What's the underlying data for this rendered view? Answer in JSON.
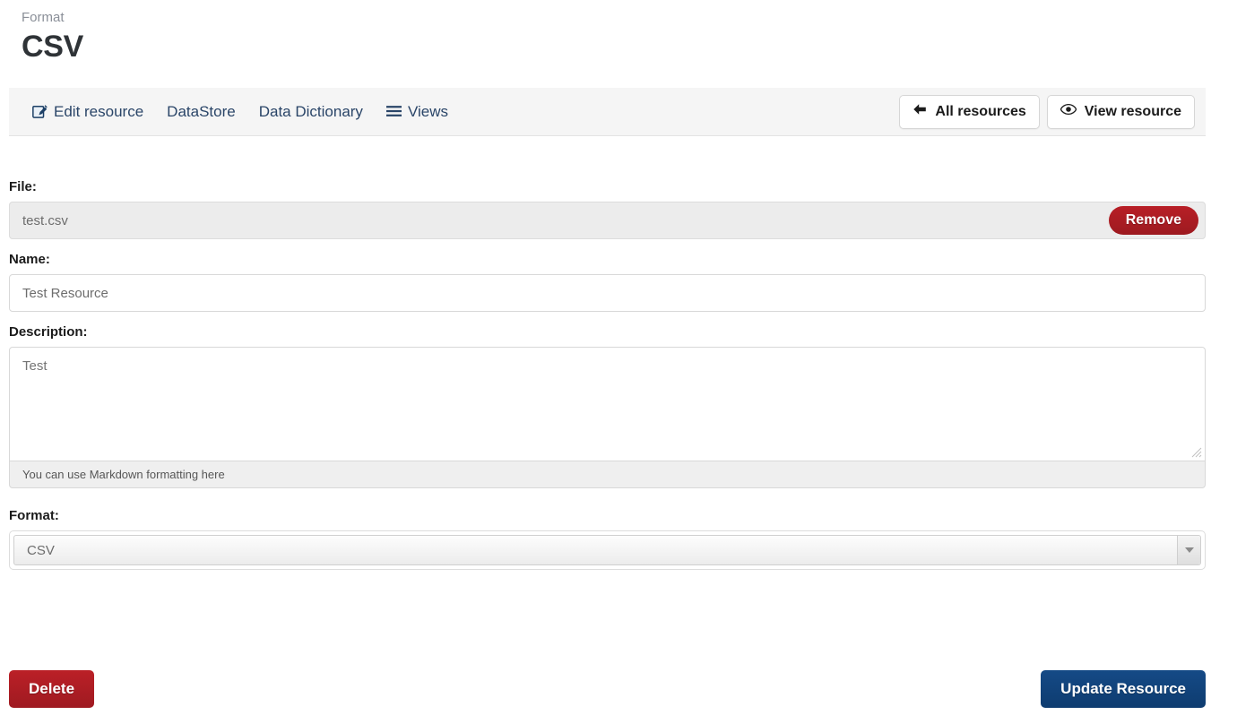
{
  "header": {
    "eyebrow": "Format",
    "title": "CSV"
  },
  "nav": {
    "tabs": [
      {
        "label": "Edit resource",
        "icon": "edit-square-icon",
        "active": true
      },
      {
        "label": "DataStore",
        "icon": "",
        "active": false
      },
      {
        "label": "Data Dictionary",
        "icon": "",
        "active": false
      },
      {
        "label": "Views",
        "icon": "hamburger-icon",
        "active": false
      }
    ],
    "actions": [
      {
        "label": "All resources",
        "icon": "arrow-left-icon"
      },
      {
        "label": "View resource",
        "icon": "eye-icon"
      }
    ]
  },
  "form": {
    "file": {
      "label": "File:",
      "value": "test.csv",
      "remove_label": "Remove"
    },
    "name": {
      "label": "Name:",
      "value": "",
      "placeholder": "Test Resource"
    },
    "description": {
      "label": "Description:",
      "value": "",
      "placeholder": "Test",
      "hint": "You can use Markdown formatting here"
    },
    "format": {
      "label": "Format:",
      "value": "CSV",
      "placeholder": "CSV",
      "options": [
        "CSV"
      ]
    }
  },
  "footer": {
    "delete_label": "Delete",
    "update_label": "Update Resource"
  },
  "colors": {
    "danger": "#b81f26",
    "primary": "#10417a",
    "nav_link": "#2a4568",
    "navbar_bg": "#f5f5f5",
    "muted_text": "#6d6d6d"
  }
}
